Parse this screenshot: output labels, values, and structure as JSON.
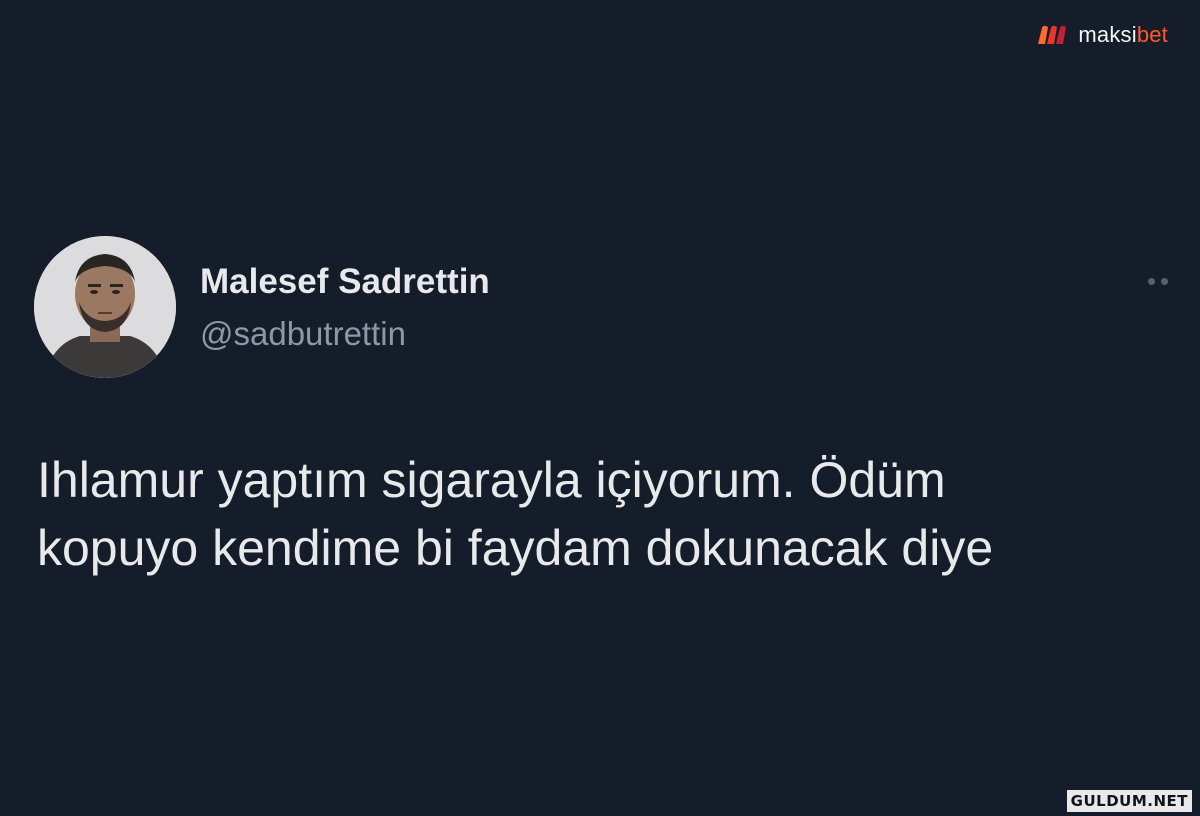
{
  "brand": {
    "name_part1": "maksi",
    "name_part2": "bet",
    "logo_colors": [
      "#ff5a2b",
      "#c21f3a"
    ]
  },
  "tweet": {
    "display_name": "Malesef Sadrettin",
    "username": "@sadbutrettin",
    "text_lines": [
      "Ihlamur yaptım sigarayla içiyorum. Ödüm",
      "kopuyo kendime bi faydam dokunacak diye"
    ],
    "more_icon": "more-dots-icon"
  },
  "watermark": {
    "site": "GULDUM.NET"
  },
  "colors": {
    "background": "#161d2a",
    "text_primary": "#e7e9ea",
    "text_secondary": "#8b98a5"
  }
}
